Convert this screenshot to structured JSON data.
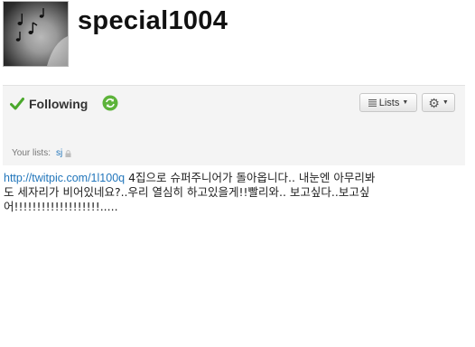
{
  "profile": {
    "username": "special1004"
  },
  "actions": {
    "following_label": "Following",
    "lists_label": "Lists"
  },
  "lists": {
    "label": "Your lists:",
    "items": [
      "sj"
    ]
  },
  "tweet": {
    "link": "http://twitpic.com/1l100q",
    "text": " 4집으로 슈퍼주니어가 돌아옵니다.. 내눈엔 아무리봐도 세자리가 비어있네요?..우리 열심히 하고있을게!!빨리와.. 보고싶다..보고싶어!!!!!!!!!!!!!!!!!!!....."
  },
  "icons": {
    "following": "check-icon",
    "refresh": "refresh-icon",
    "lists": "list-lines-icon",
    "settings": "gear-icon",
    "private": "lock-icon"
  },
  "colors": {
    "link": "#2276bb",
    "check": "#4aa82b",
    "refresh": "#5db33a",
    "panel": "#f4f4f4"
  }
}
